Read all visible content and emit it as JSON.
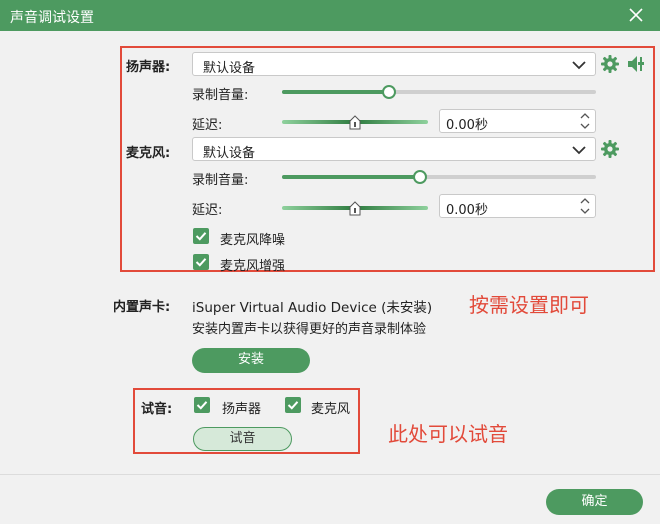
{
  "window": {
    "title": "声音调试设置"
  },
  "speaker": {
    "label": "扬声器:",
    "device": "默认设备",
    "volume_label": "录制音量:",
    "volume_level": 0.34,
    "delay_label": "延迟:",
    "delay_value": "0.00秒"
  },
  "microphone": {
    "label": "麦克风:",
    "device": "默认设备",
    "volume_label": "录制音量:",
    "volume_level": 0.44,
    "delay_label": "延迟:",
    "delay_value": "0.00秒",
    "noise_reduction_label": "麦克风降噪",
    "noise_reduction_checked": true,
    "enhance_label": "麦克风增强",
    "enhance_checked": true
  },
  "builtin_card": {
    "label": "内置声卡:",
    "device_name": "iSuper Virtual Audio Device (未安装)",
    "hint": "安装内置声卡以获得更好的声音录制体验",
    "install_label": "安装"
  },
  "test": {
    "label": "试音:",
    "speaker_label": "扬声器",
    "speaker_checked": true,
    "mic_label": "麦克风",
    "mic_checked": true,
    "button_label": "试音"
  },
  "annotations": {
    "settings_note": "按需设置即可",
    "test_note": "此处可以试音"
  },
  "footer": {
    "confirm_label": "确定"
  },
  "colors": {
    "accent": "#4d9a60",
    "annotation": "#e24a3a"
  }
}
